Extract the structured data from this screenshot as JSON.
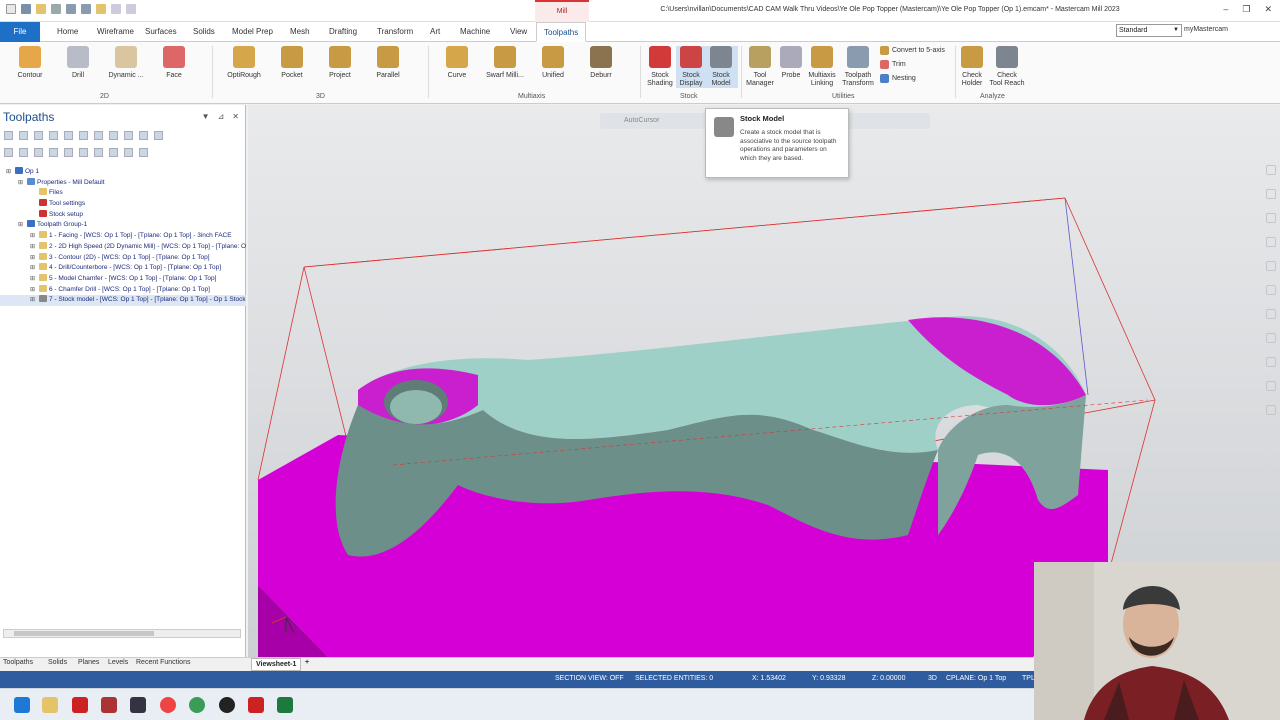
{
  "app": {
    "mode_tab": "Mill",
    "window_title": "C:\\Users\\nvillan\\Documents\\CAD CAM Walk Thru Videos\\Ye Ole Pop Topper (Mastercam)\\Ye Ole Pop Topper (Op 1).emcam* - Mastercam Mill 2023",
    "workspace": "Standard",
    "account": "myMastercam"
  },
  "tabs": [
    "File",
    "Home",
    "Wireframe",
    "Surfaces",
    "Solids",
    "Model Prep",
    "Mesh",
    "Drafting",
    "Transform",
    "Art",
    "Machine",
    "View",
    "Toolpaths"
  ],
  "active_tab": "Toolpaths",
  "ribbon": {
    "b2d": [
      "Contour",
      "Drill",
      "Dynamic ...",
      "Face"
    ],
    "b3d": [
      "OptiRough",
      "Pocket",
      "Project",
      "Parallel"
    ],
    "multiaxis": [
      "Curve",
      "Swarf Milli...",
      "Unified",
      "Deburr"
    ],
    "stock": [
      [
        "Stock",
        "Shading"
      ],
      [
        "Stock",
        "Display"
      ],
      [
        "Stock",
        "Model"
      ]
    ],
    "utilities": [
      [
        "Tool",
        "Manager"
      ],
      [
        "Probe",
        ""
      ],
      [
        "Multiaxis",
        "Linking"
      ],
      [
        "Toolpath",
        "Transform"
      ]
    ],
    "utilities_small": [
      "Convert to 5-axis",
      "Trim",
      "Nesting"
    ],
    "analyze": [
      [
        "Check",
        "Holder"
      ],
      [
        "Check",
        "Tool Reach"
      ]
    ],
    "groups": [
      "2D",
      "3D",
      "Multiaxis",
      "Stock",
      "Utilities",
      "Analyze"
    ]
  },
  "tooltip": {
    "title": "Stock Model",
    "desc": "Create a stock model that is associative to the source toolpath operations and parameters on which they are based."
  },
  "panel": {
    "title": "Toolpaths",
    "tree": [
      {
        "t": "Op 1",
        "d": 0,
        "c": "#3a6fc4"
      },
      {
        "t": "Properties - Mill Default",
        "d": 1,
        "c": "#5a8ad0"
      },
      {
        "t": "Files",
        "d": 2,
        "c": "#e4c46a"
      },
      {
        "t": "Tool settings",
        "d": 2,
        "c": "#c33"
      },
      {
        "t": "Stock setup",
        "d": 2,
        "c": "#c33"
      },
      {
        "t": "Toolpath Group-1",
        "d": 1,
        "c": "#3a6fc4"
      },
      {
        "t": "1 - Facing - [WCS: Op 1 Top] - [Tplane: Op 1 Top] - 3inch FACE",
        "d": 2,
        "c": "#e4c46a"
      },
      {
        "t": "2 - 2D High Speed (2D Dynamic Mill) - [WCS: Op 1 Top] - [Tplane: Op 1 Top]",
        "d": 2,
        "c": "#e4c46a"
      },
      {
        "t": "3 - Contour (2D) - [WCS: Op 1 Top] - [Tplane: Op 1 Top]",
        "d": 2,
        "c": "#e4c46a"
      },
      {
        "t": "4 - Drill/Counterbore - [WCS: Op 1 Top] - [Tplane: Op 1 Top]",
        "d": 2,
        "c": "#e4c46a"
      },
      {
        "t": "5 - Model Chamfer - [WCS: Op 1 Top] - [Tplane: Op 1 Top]",
        "d": 2,
        "c": "#e4c46a"
      },
      {
        "t": "6 - Chamfer Drill - [WCS: Op 1 Top] - [Tplane: Op 1 Top]",
        "d": 2,
        "c": "#e4c46a"
      },
      {
        "t": "7 - Stock model - [WCS: Op 1 Top] - [Tplane: Op 1 Top] - Op 1 Stock",
        "d": 2,
        "c": "#888"
      }
    ]
  },
  "viewport": {
    "autocursor": "AutoCursor"
  },
  "bottom_tabs": [
    "Toolpaths",
    "Solids",
    "Planes",
    "Levels",
    "Recent Functions"
  ],
  "viewsheet": "Viewsheet-1",
  "status": {
    "section": "SECTION VIEW: OFF",
    "selected": "SELECTED ENTITIES: 0",
    "x": "X: 1.53402",
    "y": "Y: 0.93328",
    "z": "Z: 0.00000",
    "mode": "3D",
    "cplane": "CPLANE: Op 1 Top",
    "tp": "TPL"
  },
  "colors": {
    "accent": "#1e6fc6",
    "status": "#2e5c9e",
    "stock": "#d500d5",
    "part": "#8fb8ae"
  }
}
